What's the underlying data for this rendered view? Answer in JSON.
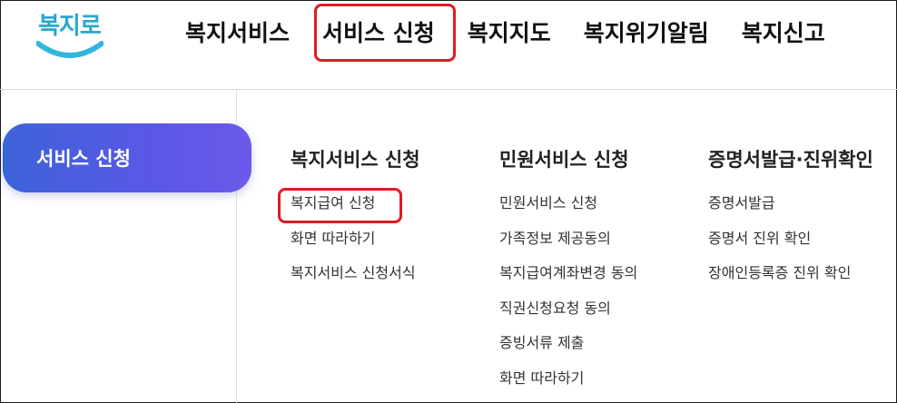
{
  "logo": {
    "text": "복지로",
    "icon": "smile-logo"
  },
  "gnb": {
    "items": [
      "복지서비스",
      "서비스 신청",
      "복지지도",
      "복지위기알림",
      "복지신고"
    ]
  },
  "sidebar": {
    "active_label": "서비스 신청"
  },
  "columns": [
    {
      "title": "복지서비스 신청",
      "items": [
        "복지급여 신청",
        "화면 따라하기",
        "복지서비스 신청서식"
      ]
    },
    {
      "title": "민원서비스 신청",
      "items": [
        "민원서비스 신청",
        "가족정보 제공동의",
        "복지급여계좌변경 동의",
        "직권신청요청 동의",
        "증빙서류 제출",
        "화면 따라하기"
      ]
    },
    {
      "title": "증명서발급·진위확인",
      "items": [
        "증명서발급",
        "증명서 진위 확인",
        "장애인등록증 진위 확인"
      ]
    }
  ],
  "colors": {
    "highlight": "#e01b24",
    "accent": "#5a58e6",
    "logo": "#2aa8c9"
  }
}
